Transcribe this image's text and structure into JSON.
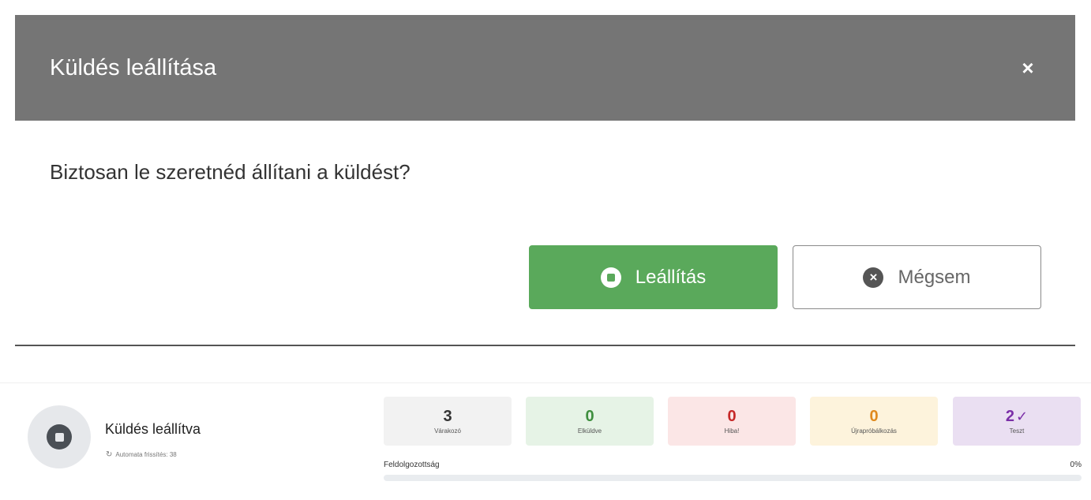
{
  "modal": {
    "title": "Küldés leállítása",
    "close_glyph": "×",
    "question": "Biztosan le szeretnéd állítani a küldést?",
    "stop_label": "Leállítás",
    "cancel_label": "Mégsem",
    "cancel_glyph": "×"
  },
  "status": {
    "title": "Küldés leállítva",
    "refresh_glyph": "↻",
    "refresh_text": "Automata frissítés: 38"
  },
  "stats": [
    {
      "value": "3",
      "label": "Várakozó",
      "color": "#333333"
    },
    {
      "value": "0",
      "label": "Elküldve",
      "color": "#3f8f3f"
    },
    {
      "value": "0",
      "label": "Hiba!",
      "color": "#c62828"
    },
    {
      "value": "0",
      "label": "Újrapróbálkozás",
      "color": "#e08a1e"
    },
    {
      "value": "2",
      "check": "✓",
      "label": "Teszt",
      "color": "#7b2fa8"
    }
  ],
  "progress": {
    "label": "Feldolgozottság",
    "percent_text": "0%",
    "fraction": 0
  },
  "colors": {
    "header_bg": "#757575",
    "stop_button_bg": "#5aa95b"
  }
}
